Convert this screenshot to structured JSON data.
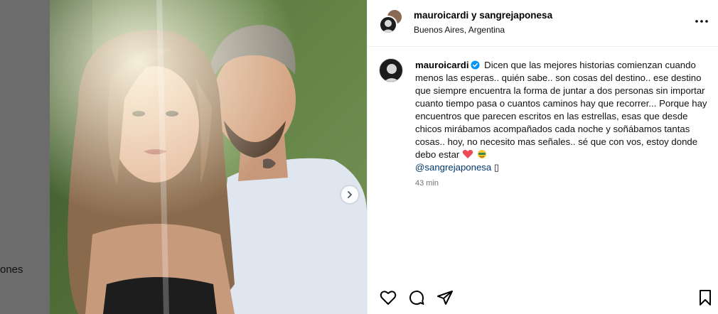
{
  "backdrop": {
    "partial_text": "ones"
  },
  "post": {
    "header": {
      "accounts": "mauroicardi y sangrejaponesa",
      "location": "Buenos Aires, Argentina"
    },
    "caption": {
      "username": "mauroicardi",
      "text": "Dicen que las mejores historias comienzan cuando menos las esperas.. quién sabe.. son cosas del destino.. ese destino que siempre encuentra la forma de juntar a dos personas sin importar cuanto tiempo pasa o cuantos caminos hay que recorrer... Porque hay encuentros que parecen escritos en las estrellas, esas que desde chicos mirábamos acompañados cada noche y soñábamos tantas cosas.. hoy, no necesito mas señales.. sé que con vos, estoy donde debo estar",
      "mention": "@sangrejaponesa",
      "trailing_glyph": "▯",
      "timestamp": "43 min"
    },
    "icons": {
      "verified": "verified-badge-icon",
      "heart_emoji": "red-heart-emoji",
      "extra_emoji": "face-emoji",
      "next": "chevron-right-icon",
      "more": "more-options-icon",
      "like": "heart-icon",
      "comment": "comment-icon",
      "share": "share-icon",
      "save": "bookmark-icon"
    },
    "colors": {
      "verified": "#0095f6",
      "mention": "#00376b",
      "heart": "#ed4956",
      "muted": "#737373"
    }
  }
}
